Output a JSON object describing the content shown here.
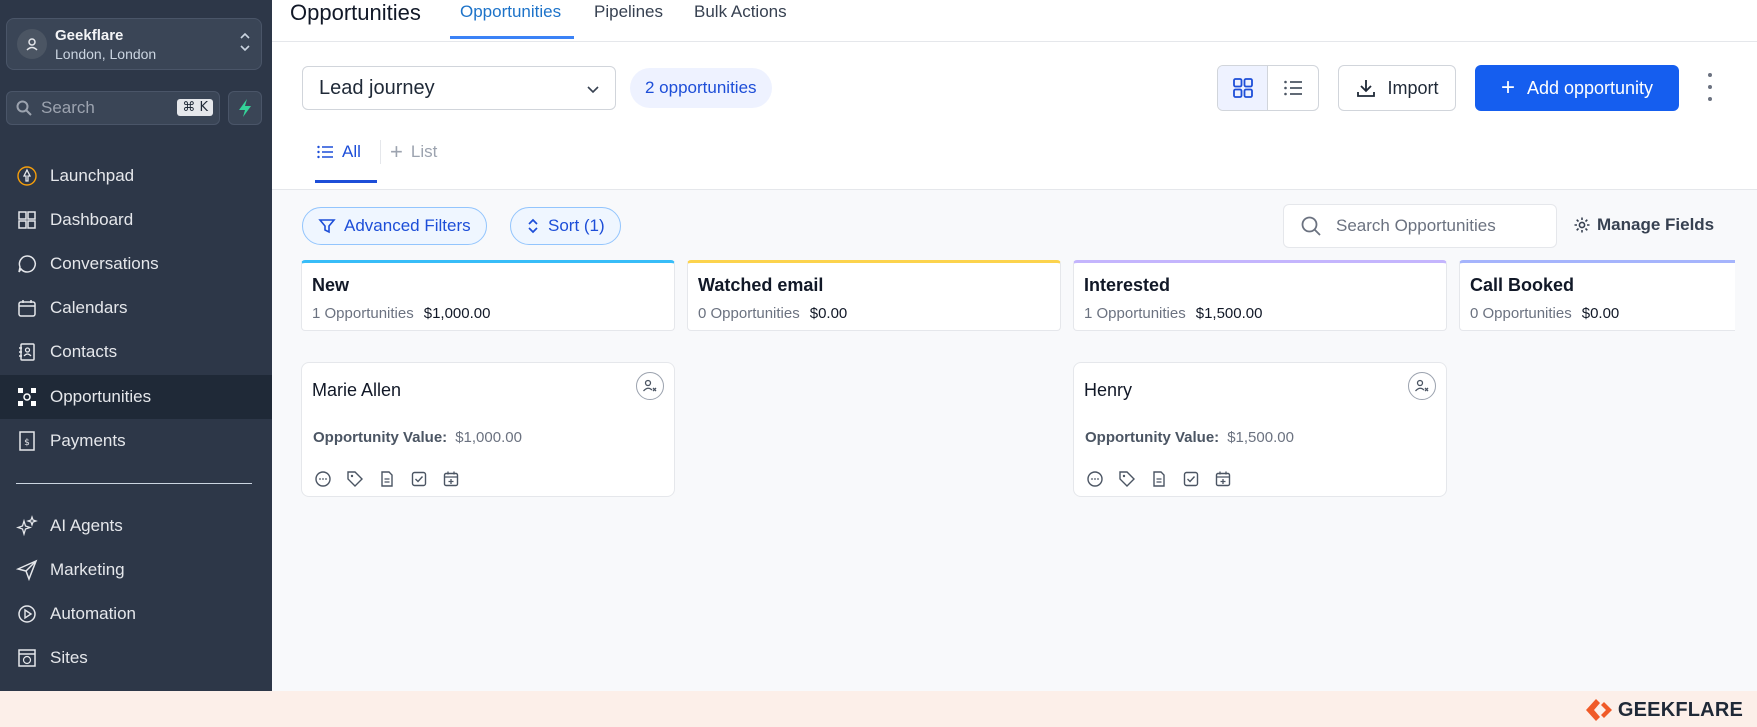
{
  "account": {
    "name": "Geekflare",
    "location": "London, London"
  },
  "search": {
    "placeholder": "Search",
    "shortcut": "⌘ K"
  },
  "sidebar": {
    "items": [
      {
        "label": "Launchpad",
        "icon": "rocket-icon"
      },
      {
        "label": "Dashboard",
        "icon": "grid-icon"
      },
      {
        "label": "Conversations",
        "icon": "chat-icon"
      },
      {
        "label": "Calendars",
        "icon": "calendar-icon"
      },
      {
        "label": "Contacts",
        "icon": "contacts-icon"
      },
      {
        "label": "Opportunities",
        "icon": "opportunities-icon",
        "active": true
      },
      {
        "label": "Payments",
        "icon": "payments-icon"
      },
      {
        "label": "AI Agents",
        "icon": "sparkle-icon"
      },
      {
        "label": "Marketing",
        "icon": "send-icon"
      },
      {
        "label": "Automation",
        "icon": "automation-icon"
      },
      {
        "label": "Sites",
        "icon": "sites-icon"
      }
    ]
  },
  "header": {
    "title": "Opportunities",
    "tabs": [
      {
        "label": "Opportunities",
        "active": true
      },
      {
        "label": "Pipelines"
      },
      {
        "label": "Bulk Actions"
      }
    ]
  },
  "toolbar": {
    "pipeline": "Lead journey",
    "count": "2 opportunities",
    "import_label": "Import",
    "add_label": "Add opportunity",
    "accent": "#155eef"
  },
  "subtabs": {
    "all": "All",
    "list": "List"
  },
  "filters": {
    "advanced": "Advanced Filters",
    "sort": "Sort (1)",
    "search_placeholder": "Search Opportunities",
    "manage": "Manage Fields"
  },
  "stages": [
    {
      "name": "New",
      "count": "1 Opportunities",
      "amount": "$1,000.00",
      "color": "#38bdf8"
    },
    {
      "name": "Watched email",
      "count": "0 Opportunities",
      "amount": "$0.00",
      "color": "#fcd34d"
    },
    {
      "name": "Interested",
      "count": "1 Opportunities",
      "amount": "$1,500.00",
      "color": "#c4b5fd"
    },
    {
      "name": "Call Booked",
      "count": "0 Opportunities",
      "amount": "$0.00",
      "color": "#a5b4fc"
    }
  ],
  "cards": [
    {
      "name": "Marie Allen",
      "value_label": "Opportunity Value:",
      "value": "$1,000.00"
    },
    {
      "name": "Henry",
      "value_label": "Opportunity Value:",
      "value": "$1,500.00"
    }
  ],
  "footer": {
    "brand": "GEEKFLARE"
  }
}
